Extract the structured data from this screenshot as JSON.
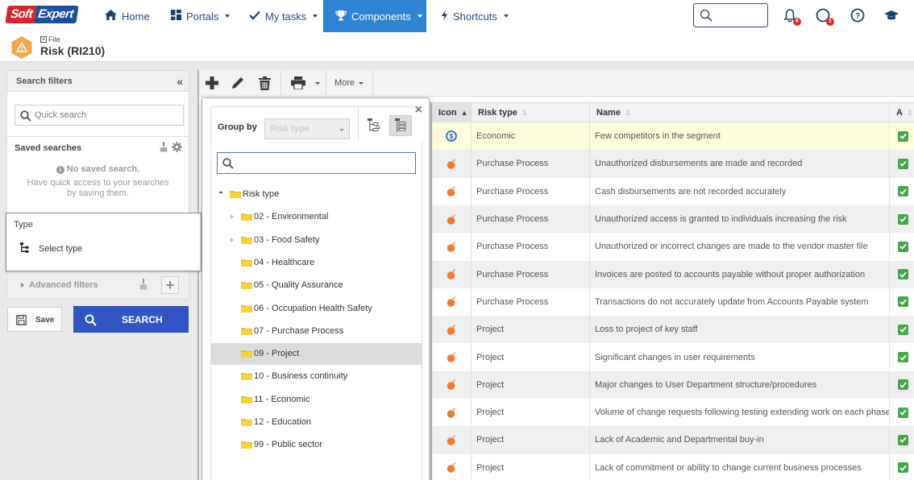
{
  "brand": {
    "part1": "Soft",
    "part2": "Expert"
  },
  "nav": {
    "items": [
      {
        "label": "Home",
        "icon": "home-icon"
      },
      {
        "label": "Portals",
        "icon": "grid-icon"
      },
      {
        "label": "My tasks",
        "icon": "check-icon"
      },
      {
        "label": "Components",
        "icon": "trophy-icon",
        "active": true
      },
      {
        "label": "Shortcuts",
        "icon": "bolt-icon"
      }
    ],
    "notifications_count": "6",
    "tasks_count": "1"
  },
  "page": {
    "breadcrumb": "File",
    "title": "Risk (RI210)"
  },
  "filters": {
    "title": "Search filters",
    "quick_search_placeholder": "Quick search",
    "saved_title": "Saved searches",
    "no_saved": "No saved search.",
    "saved_help": "Have quick access to your searches by saving them.",
    "type_label": "Type",
    "type_select": "Select type",
    "advanced": "Advanced filters",
    "save": "Save",
    "search": "SEARCH"
  },
  "toolbar": {
    "more": "More"
  },
  "groupby": {
    "label": "Group by",
    "selected": "Risk type",
    "search_value": "",
    "tree": [
      {
        "label": "Risk type",
        "level": 0,
        "expander": "open"
      },
      {
        "label": "02 - Environmental",
        "level": 1,
        "expander": "closed"
      },
      {
        "label": "03 - Food Safety",
        "level": 1,
        "expander": "closed"
      },
      {
        "label": "04 - Healthcare",
        "level": 1,
        "expander": ""
      },
      {
        "label": "05 - Quality Assurance",
        "level": 1,
        "expander": ""
      },
      {
        "label": "06 - Occupation Health Safety",
        "level": 1,
        "expander": ""
      },
      {
        "label": "07 - Purchase Process",
        "level": 1,
        "expander": ""
      },
      {
        "label": "09 - Project",
        "level": 1,
        "expander": "",
        "selected": true
      },
      {
        "label": "10 - Business continuity",
        "level": 1,
        "expander": ""
      },
      {
        "label": "11 - Economic",
        "level": 1,
        "expander": ""
      },
      {
        "label": "12 - Education",
        "level": 1,
        "expander": ""
      },
      {
        "label": "99 - Public sector",
        "level": 1,
        "expander": ""
      }
    ]
  },
  "grid": {
    "columns": [
      "Icon",
      "Risk type",
      "Name",
      "A"
    ],
    "rows": [
      {
        "icon": "dollar-icon",
        "type": "Economic",
        "name": "Few competitors in the segment",
        "active": true
      },
      {
        "icon": "bomb-icon",
        "type": "Purchase Process",
        "name": "Unauthorized disbursements are made and recorded",
        "active": true
      },
      {
        "icon": "bomb-icon",
        "type": "Purchase Process",
        "name": "Cash disbursements are not recorded accurately",
        "active": true
      },
      {
        "icon": "bomb-icon",
        "type": "Purchase Process",
        "name": "Unauthorized access is granted to individuals increasing the risk",
        "active": true
      },
      {
        "icon": "bomb-icon",
        "type": "Purchase Process",
        "name": "Unauthorized or incorrect changes are made to the vendor master file",
        "active": true
      },
      {
        "icon": "bomb-icon",
        "type": "Purchase Process",
        "name": "Invoices are posted to accounts payable without proper authorization",
        "active": true
      },
      {
        "icon": "bomb-icon",
        "type": "Purchase Process",
        "name": "Transactions do not accurately update from Accounts Payable system",
        "active": true
      },
      {
        "icon": "bomb-icon",
        "type": "Project",
        "name": "Loss to project of key staff",
        "active": true
      },
      {
        "icon": "bomb-icon",
        "type": "Project",
        "name": "Significant changes in user requirements",
        "active": true
      },
      {
        "icon": "bomb-icon",
        "type": "Project",
        "name": "Major changes to User Department structure/procedures",
        "active": true
      },
      {
        "icon": "bomb-icon",
        "type": "Project",
        "name": "Volume of change requests following testing extending work on each phase.",
        "active": true
      },
      {
        "icon": "bomb-icon",
        "type": "Project",
        "name": "Lack of Academic and Departmental buy-in",
        "active": true
      },
      {
        "icon": "bomb-icon",
        "type": "Project",
        "name": "Lack of commitment or ability to change current business processes",
        "active": true
      }
    ]
  },
  "colors": {
    "accent": "#2e83d2",
    "search_button": "#2f56c2",
    "check": "#43a649",
    "selected_row": "#fdfcd9",
    "bomb": "#f07a2c",
    "dollar": "#2d6cc4"
  }
}
